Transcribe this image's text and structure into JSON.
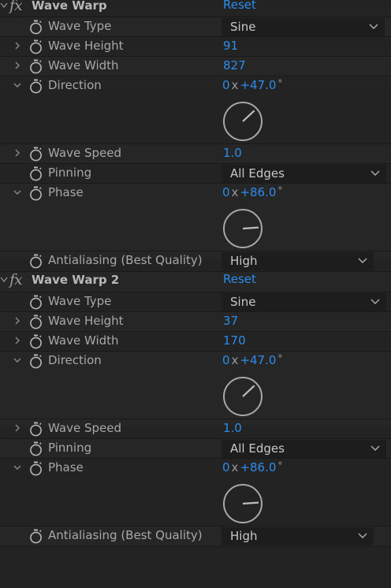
{
  "effects": [
    {
      "name": "Wave Warp",
      "reset_label": "Reset",
      "properties": {
        "wave_type": {
          "label": "Wave Type",
          "value": "Sine"
        },
        "wave_height": {
          "label": "Wave Height",
          "value": "91"
        },
        "wave_width": {
          "label": "Wave Width",
          "value": "827"
        },
        "direction": {
          "label": "Direction",
          "revolutions": "0",
          "x_sep": "x",
          "degrees": "+47.0",
          "degree_symbol": "°",
          "angle_deg": 47.0
        },
        "wave_speed": {
          "label": "Wave Speed",
          "value": "1.0"
        },
        "pinning": {
          "label": "Pinning",
          "value": "All Edges"
        },
        "phase": {
          "label": "Phase",
          "revolutions": "0",
          "x_sep": "x",
          "degrees": "+86.0",
          "degree_symbol": "°",
          "angle_deg": 86.0
        },
        "antialiasing": {
          "label": "Antialiasing (Best Quality)",
          "value": "High"
        }
      }
    },
    {
      "name": "Wave Warp 2",
      "reset_label": "Reset",
      "properties": {
        "wave_type": {
          "label": "Wave Type",
          "value": "Sine"
        },
        "wave_height": {
          "label": "Wave Height",
          "value": "37"
        },
        "wave_width": {
          "label": "Wave Width",
          "value": "170"
        },
        "direction": {
          "label": "Direction",
          "revolutions": "0",
          "x_sep": "x",
          "degrees": "+47.0",
          "degree_symbol": "°",
          "angle_deg": 47.0
        },
        "wave_speed": {
          "label": "Wave Speed",
          "value": "1.0"
        },
        "pinning": {
          "label": "Pinning",
          "value": "All Edges"
        },
        "phase": {
          "label": "Phase",
          "revolutions": "0",
          "x_sep": "x",
          "degrees": "+86.0",
          "degree_symbol": "°",
          "angle_deg": 86.0
        },
        "antialiasing": {
          "label": "Antialiasing (Best Quality)",
          "value": "High"
        }
      }
    }
  ],
  "icons": {
    "effect": "fx-icon",
    "stopwatch": "stopwatch-icon",
    "twirl": "chevron-right-icon",
    "dropdown": "chevron-down-icon"
  },
  "colors": {
    "background": "#232323",
    "value_blue": "#2d8ceb",
    "label": "#a8a8a8",
    "dropdown_bg": "#1d1d1d"
  }
}
